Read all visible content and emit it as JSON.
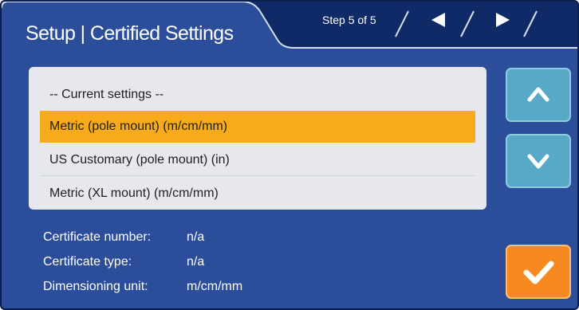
{
  "header": {
    "title": "Setup | Certified Settings",
    "step": "Step 5 of 5"
  },
  "navigation": {
    "prev_icon": "triangle-left-icon",
    "next_icon": "triangle-right-icon"
  },
  "settings_list": {
    "header": "-- Current settings --",
    "items": [
      {
        "label": "Metric (pole mount) (m/cm/mm)",
        "selected": true
      },
      {
        "label": "US Customary (pole mount) (in)",
        "selected": false
      },
      {
        "label": "Metric (XL mount) (m/cm/mm)",
        "selected": false
      }
    ]
  },
  "info": {
    "certificate_number": {
      "label": "Certificate number:",
      "value": "n/a"
    },
    "certificate_type": {
      "label": "Certificate type:",
      "value": "n/a"
    },
    "dimensioning_unit": {
      "label": "Dimensioning unit:",
      "value": "m/cm/mm"
    }
  },
  "buttons": {
    "scroll_up_icon": "chevron-up-icon",
    "scroll_down_icon": "chevron-down-icon",
    "confirm_icon": "checkmark-icon"
  },
  "colors": {
    "background": "#2b4d9a",
    "header_dark": "#0f2a66",
    "selected_row": "#f7ab1a",
    "scroll_button": "#58a9c7",
    "confirm_button": "#f6891f"
  }
}
